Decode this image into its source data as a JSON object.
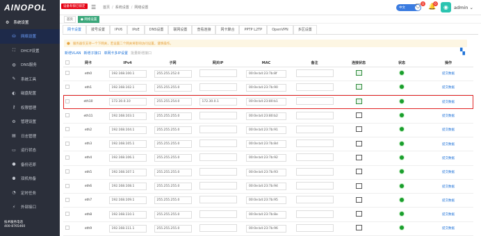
{
  "brand": {
    "logo": "AINOPOL"
  },
  "sidebar": {
    "group": {
      "label": "系统设置",
      "icon": "gear-icon"
    },
    "items": [
      {
        "label": "网络设置",
        "icon": "network-icon",
        "active": true
      },
      {
        "label": "DHCP设置",
        "icon": "sitemap-icon"
      },
      {
        "label": "DNS服务",
        "icon": "globe-icon"
      },
      {
        "label": "系统工具",
        "icon": "wrench-icon"
      },
      {
        "label": "磁盘配置",
        "icon": "disk-icon"
      },
      {
        "label": "权限管理",
        "icon": "key-icon"
      },
      {
        "label": "管理设置",
        "icon": "settings-icon"
      },
      {
        "label": "日志管理",
        "icon": "file-icon"
      },
      {
        "label": "运行状态",
        "icon": "monitor-icon"
      },
      {
        "label": "备份还原",
        "icon": "user-icon"
      },
      {
        "label": "双机热备",
        "icon": "users-icon"
      },
      {
        "label": "定时任务",
        "icon": "clock-icon"
      },
      {
        "label": "外部接口",
        "icon": "plug-icon"
      }
    ],
    "footer_title": "技术服务电话",
    "footer_phone": "400-8765460"
  },
  "topbar": {
    "lock_label": "设备有锁已锁定",
    "crumbs": [
      "首页",
      "系统设置",
      "网络设置"
    ],
    "toggle_label": "中文",
    "badge1": "0",
    "badge2": "0",
    "username": "admin"
  },
  "page_tabs": [
    {
      "label": "首页",
      "active": false
    },
    {
      "label": "● 网络设置",
      "active": true
    }
  ],
  "sub_tabs": [
    {
      "label": "网卡设置",
      "active": true
    },
    {
      "label": "拨号设置"
    },
    {
      "label": "IPV6"
    },
    {
      "label": "IPoE"
    },
    {
      "label": "DNS设置"
    },
    {
      "label": "联网设置"
    },
    {
      "label": "查看连接"
    },
    {
      "label": "网卡聚合"
    },
    {
      "label": "PPTP L2TP"
    },
    {
      "label": "OpenVPN"
    },
    {
      "label": "多区设置"
    }
  ],
  "alert": "服务器仅支持一个下网关，若设置二个网关将影响访问设置，谨慎操作。",
  "actions": [
    {
      "label": "新增VLAN",
      "enabled": true
    },
    {
      "label": "新增子接口",
      "enabled": true
    },
    {
      "label": "单网卡多IP设置",
      "enabled": true
    },
    {
      "label": "批量新增接口",
      "enabled": false
    }
  ],
  "table": {
    "columns": [
      "网卡",
      "IPv4",
      "子网",
      "网关IP",
      "MAC",
      "备注",
      "连接状态",
      "状态",
      "操作"
    ],
    "op_label": "提交数据",
    "rows": [
      {
        "nic": "eth0",
        "ip": "192.168.100.1",
        "mask": "255.255.252.0",
        "gw": "",
        "mac": "00:0e:b4:23:7b:8f",
        "linked": true,
        "hl": false
      },
      {
        "nic": "eth1",
        "ip": "192.168.102.1",
        "mask": "255.255.255.0",
        "gw": "",
        "mac": "00:0e:b4:23:7b:90",
        "linked": true,
        "hl": false
      },
      {
        "nic": "eth10",
        "ip": "172.30.0.10",
        "mask": "255.255.254.0",
        "gw": "172.30.0.1",
        "mac": "00:0e:b4:23:80:b1",
        "linked": true,
        "hl": true
      },
      {
        "nic": "eth11",
        "ip": "192.168.103.1",
        "mask": "255.255.255.0",
        "gw": "",
        "mac": "00:0e:b4:23:80:b2",
        "linked": false,
        "hl": false
      },
      {
        "nic": "eth2",
        "ip": "192.168.104.1",
        "mask": "255.255.255.0",
        "gw": "",
        "mac": "00:0e:b4:23:7b:91",
        "linked": false,
        "hl": false
      },
      {
        "nic": "eth3",
        "ip": "192.168.105.1",
        "mask": "255.255.255.0",
        "gw": "",
        "mac": "00:0e:b4:23:7b:8d",
        "linked": false,
        "hl": false
      },
      {
        "nic": "eth4",
        "ip": "192.168.106.1",
        "mask": "255.255.255.0",
        "gw": "",
        "mac": "00:0e:b4:23:7b:92",
        "linked": false,
        "hl": false
      },
      {
        "nic": "eth5",
        "ip": "192.168.107.1",
        "mask": "255.255.255.0",
        "gw": "",
        "mac": "00:0e:b4:23:7b:93",
        "linked": false,
        "hl": false
      },
      {
        "nic": "eth6",
        "ip": "192.168.108.1",
        "mask": "255.255.255.0",
        "gw": "",
        "mac": "00:0e:b4:23:7b:94",
        "linked": false,
        "hl": false
      },
      {
        "nic": "eth7",
        "ip": "192.168.109.1",
        "mask": "255.255.255.0",
        "gw": "",
        "mac": "00:0e:b4:23:7b:95",
        "linked": false,
        "hl": false
      },
      {
        "nic": "eth8",
        "ip": "192.168.110.1",
        "mask": "255.255.255.0",
        "gw": "",
        "mac": "00:0e:b4:23:7b:8e",
        "linked": false,
        "hl": false
      },
      {
        "nic": "eth9",
        "ip": "192.168.111.1",
        "mask": "255.255.255.0",
        "gw": "",
        "mac": "00:0e:b4:23:7b:96",
        "linked": false,
        "hl": false
      }
    ]
  },
  "colors": {
    "accent": "#1e72d8",
    "sidebar_bg": "#2b2f3a",
    "status_ok": "#1a9e2d",
    "highlight": "#e02020"
  }
}
